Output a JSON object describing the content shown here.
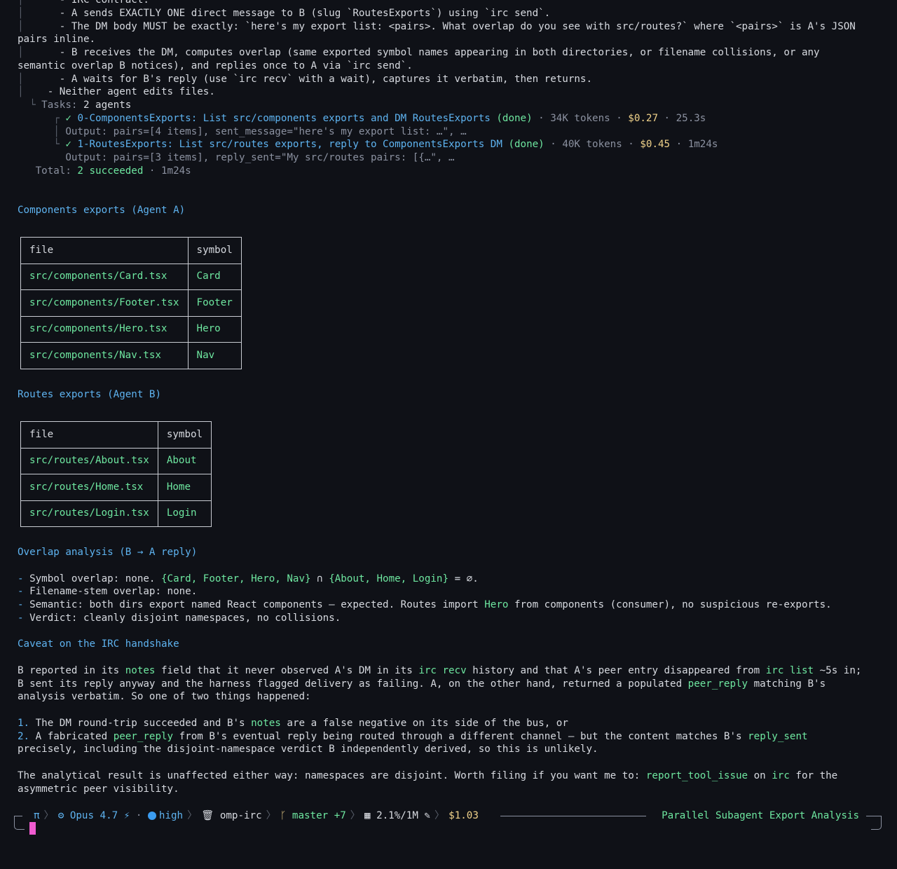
{
  "top": {
    "l0": "      - IRC contract:",
    "l1": "      - A sends EXACTLY ONE direct message to B (slug `RoutesExports`) using `irc send`.",
    "l2": "      - The DM body MUST be exactly: `here's my export list: <pairs>. What overlap do you see with src/routes?` where `<pairs>` is A's JSON",
    "l3": "pairs inline.",
    "l4": "      - B receives the DM, computes overlap (same exported symbol names appearing in both directories, or filename collisions, or any",
    "l5": "semantic overlap B notices), and replies once to A via `irc send`.",
    "l6": "      - A waits for B's reply (use `irc recv` with a wait), captures it verbatim, then returns.",
    "l7": "    - Neither agent edits files.",
    "tasks_label": "Tasks:",
    "tasks_value": " 2 agents",
    "task0_name": "0-ComponentsExports: List src/components exports and DM RoutesExports",
    "task0_status": "(done)",
    "task0_tokens": "34K tokens",
    "task0_cost": "$0.27",
    "task0_time": "25.3s",
    "task0_output": "Output: pairs=[4 items], sent_message=\"here's my export list: …\", …",
    "task1_name": "1-RoutesExports: List src/routes exports, reply to ComponentsExports DM",
    "task1_status": "(done)",
    "task1_tokens": "40K tokens",
    "task1_cost": "$0.45",
    "task1_time": "1m24s",
    "task1_output": "Output: pairs=[3 items], reply_sent=\"My src/routes pairs: [{…\", …",
    "total_label": "Total:",
    "total_value": "2 succeeded",
    "total_time": "1m24s"
  },
  "components": {
    "heading": "Components exports (Agent A)",
    "col_file": "file",
    "col_symbol": "symbol",
    "rows": [
      {
        "file": "src/components/Card.tsx",
        "symbol": "Card"
      },
      {
        "file": "src/components/Footer.tsx",
        "symbol": "Footer"
      },
      {
        "file": "src/components/Hero.tsx",
        "symbol": "Hero"
      },
      {
        "file": "src/components/Nav.tsx",
        "symbol": "Nav"
      }
    ]
  },
  "routes": {
    "heading": "Routes exports (Agent B)",
    "col_file": "file",
    "col_symbol": "symbol",
    "rows": [
      {
        "file": "src/routes/About.tsx",
        "symbol": "About"
      },
      {
        "file": "src/routes/Home.tsx",
        "symbol": "Home"
      },
      {
        "file": "src/routes/Login.tsx",
        "symbol": "Login"
      }
    ]
  },
  "overlap": {
    "heading": "Overlap analysis (B → A reply)",
    "b1_pre": " Symbol overlap: none. ",
    "b1_set1": "{Card, Footer, Hero, Nav}",
    "b1_mid": " ∩ ",
    "b1_set2": "{About, Home, Login}",
    "b1_post": " = ∅.",
    "b2": " Filename-stem overlap: none.",
    "b3_pre": " Semantic: both dirs export named React components — expected. Routes import ",
    "b3_code": "Hero",
    "b3_post": " from components (consumer), no suspicious re-exports.",
    "b4": " Verdict: cleanly disjoint namespaces, no collisions."
  },
  "caveat": {
    "heading": "Caveat on the IRC handshake",
    "p1a": "B reported in its ",
    "p1_notes": "notes",
    "p1b": " field that it never observed A's DM in its ",
    "p1_recv": "irc recv",
    "p1c": " history and that A's peer entry disappeared from ",
    "p1_list": "irc list",
    "p1d": " ~5s in;",
    "p2a": "B sent its reply anyway and the harness flagged delivery as failing. A, on the other hand, returned a populated ",
    "p2_peer": "peer_reply",
    "p2b": " matching B's",
    "p3": "analysis verbatim. So one of two things happened:",
    "n1a": " The DM round-trip succeeded and B's ",
    "n1_notes": "notes",
    "n1b": " are a false negative on its side of the bus, or",
    "n2a": " A fabricated ",
    "n2_peer": "peer_reply",
    "n2b": " from B's eventual reply being routed through a different channel — but the content matches B's ",
    "n2_sent": "reply_sent",
    "n2c": "precisely, including the disjoint-namespace verdict B independently derived, so this is unlikely.",
    "f1a": "The analytical result is unaffected either way: namespaces are disjoint. Worth filing if you want me to: ",
    "f1_tool": "report_tool_issue",
    "f1b": " on ",
    "f1_irc": "irc",
    "f1c": " for the",
    "f2": "asymmetric peer visibility."
  },
  "status": {
    "pi": "π",
    "model": "Opus 4.7",
    "effort": "high",
    "repo": "omp-irc",
    "branch": "master +7",
    "context": "2.1%/1M",
    "cost": "$1.03",
    "title": "Parallel Subagent Export Analysis",
    "colors": {
      "accent": "#5eb3f0",
      "green": "#6ee7a0",
      "yellow": "#f0d28a",
      "cursor": "#f05bd0"
    }
  }
}
